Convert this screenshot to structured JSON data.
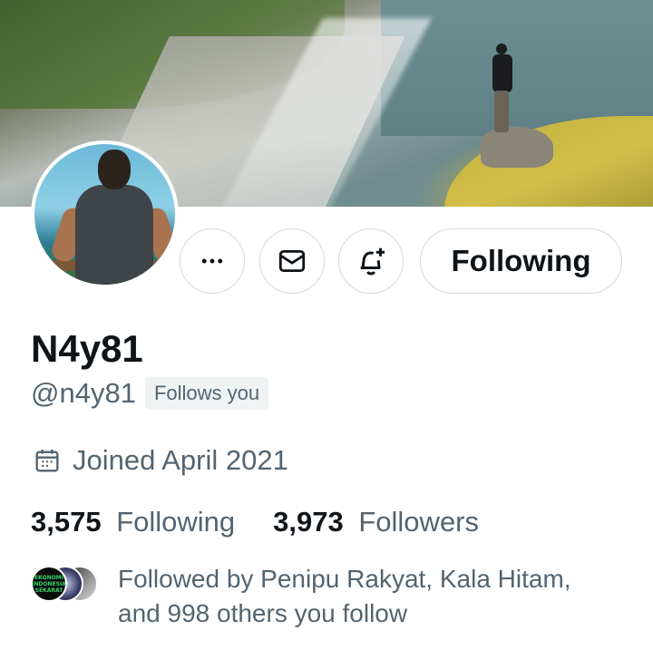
{
  "profile": {
    "display_name": "N4y81",
    "handle": "@n4y81",
    "follows_you_badge": "Follows you",
    "joined": "Joined April 2021"
  },
  "actions": {
    "more_icon": "more-horizontal-icon",
    "message_icon": "envelope-icon",
    "notify_icon": "bell-plus-icon",
    "following_label": "Following"
  },
  "stats": {
    "following_count": "3,575",
    "following_label": "Following",
    "followers_count": "3,973",
    "followers_label": "Followers"
  },
  "followed_by": {
    "text_line1": "Followed by Penipu Rakyat, Kala Hitam,",
    "text_line2": "and 998 others you follow",
    "avatar1_caption": "EKONOMI INDONESIA SEKARAT"
  },
  "colors": {
    "text_primary": "#0f1419",
    "text_secondary": "#536471",
    "border": "#cfd9de",
    "badge_bg": "#eff3f4"
  }
}
